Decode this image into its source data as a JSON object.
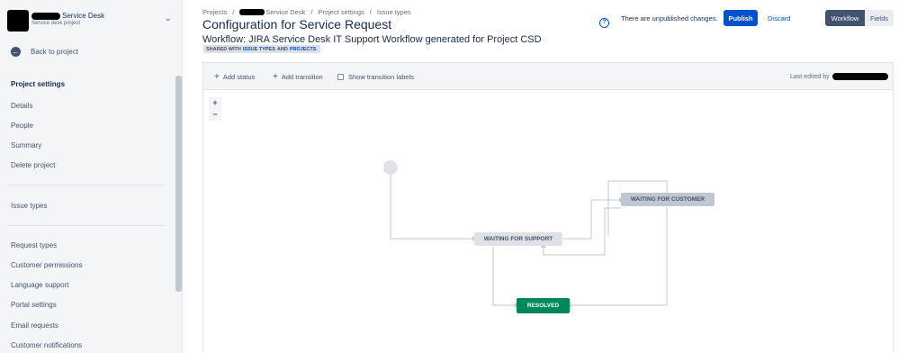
{
  "sidebar": {
    "project_name": "Service Desk",
    "project_type": "Service desk project",
    "back_link": "Back to project",
    "section_heading": "Project settings",
    "group1": [
      "Details",
      "People",
      "Summary",
      "Delete project"
    ],
    "group2": [
      "Issue types"
    ],
    "group3": [
      "Request types",
      "Customer permissions",
      "Language support",
      "Portal settings",
      "Email requests",
      "Customer notifications"
    ]
  },
  "breadcrumb": {
    "projects": "Projects",
    "service_desk": "Service Desk",
    "project_settings": "Project settings",
    "issue_types": "Issue types"
  },
  "page": {
    "title": "Configuration for Service Request",
    "workflow_title": "Workflow: JIRA Service Desk IT Support Workflow generated for Project CSD",
    "shared_prefix": "SHARED WITH",
    "shared_issue_types": "ISSUE TYPES",
    "shared_and": "AND",
    "shared_projects": "PROJECTS"
  },
  "header_actions": {
    "unpublished_text": "There are unpublished changes.",
    "publish_label": "Publish",
    "discard_label": "Discard",
    "workflow_tab": "Workflow",
    "fields_tab": "Fields"
  },
  "toolbar": {
    "add_status": "Add status",
    "add_transition": "Add transition",
    "show_labels": "Show transition labels",
    "last_edited": "Last edited by"
  },
  "zoom": {
    "zoom_in": "+",
    "zoom_out": "−"
  },
  "statuses": {
    "waiting_support": "WAITING FOR SUPPORT",
    "waiting_customer": "WAITING FOR CUSTOMER",
    "resolved": "RESOLVED"
  },
  "colors": {
    "accent": "#0052cc",
    "resolved": "#00875a",
    "status_grey": "#dfe1e6",
    "sidebar_bg": "#f4f5f7"
  },
  "icons": [
    "chevron-down-icon",
    "back-arrow-icon",
    "help-icon",
    "plus-icon",
    "checkbox-icon"
  ]
}
